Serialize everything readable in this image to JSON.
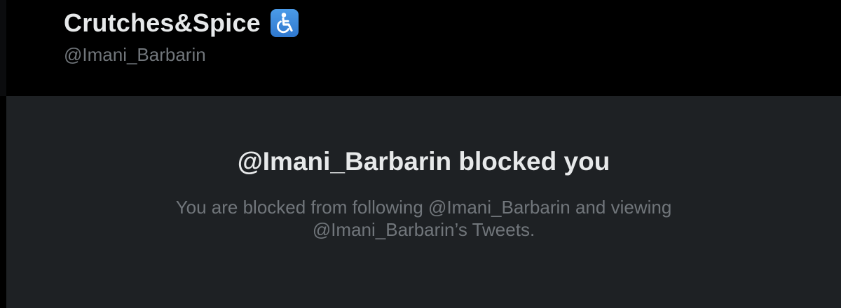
{
  "profile": {
    "display_name": "Crutches&Spice",
    "name_badge_icon": "wheelchair-accessibility-icon",
    "handle": "@Imani_Barbarin"
  },
  "blocked_notice": {
    "title": "@Imani_Barbarin blocked you",
    "message_line1": "You are blocked from following @Imani_Barbarin and viewing",
    "message_line2": "@Imani_Barbarin’s Tweets."
  },
  "colors": {
    "background": "#000000",
    "panel": "#1e2124",
    "primary_text": "#e7e9ea",
    "secondary_text": "#71767b",
    "badge_blue": "#3b88dc"
  }
}
